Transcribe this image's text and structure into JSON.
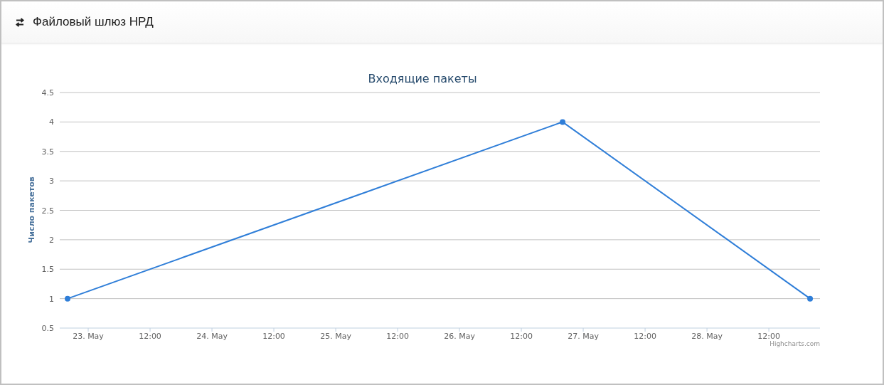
{
  "header": {
    "title": "Файловый шлюз НРД"
  },
  "chart": {
    "credits": "Highcharts.com",
    "chart_data": {
      "type": "line",
      "title": "Входящие пакеты",
      "ylabel": "Число пакетов",
      "categories": [
        null,
        "23. May",
        null,
        null,
        "12:00",
        null,
        null,
        "24. May",
        null,
        null,
        "12:00",
        null,
        null,
        "25. May",
        null,
        null,
        "12:00",
        null,
        null,
        "26. May",
        null,
        null,
        "12:00",
        null,
        null,
        "27. May",
        null,
        null,
        "12:00",
        null,
        null,
        "28. May",
        null,
        null,
        "12:00",
        null,
        null
      ],
      "grid": true,
      "series": [
        {
          "color": "#2f7ed8",
          "marker": true,
          "values": [
            1,
            null,
            null,
            null,
            null,
            null,
            null,
            null,
            null,
            null,
            null,
            null,
            null,
            null,
            null,
            null,
            null,
            null,
            null,
            null,
            null,
            null,
            null,
            null,
            4,
            null,
            null,
            null,
            null,
            null,
            null,
            null,
            null,
            null,
            null,
            null,
            1
          ]
        }
      ],
      "ylim": [
        0.5,
        4.5
      ],
      "yticks": [
        {
          "value": 0.5,
          "label": "0.5"
        },
        {
          "value": 1,
          "label": "1"
        },
        {
          "value": 1.5,
          "label": "1.5"
        },
        {
          "value": 2,
          "label": "2"
        },
        {
          "value": 2.5,
          "label": "2.5"
        },
        {
          "value": 3,
          "label": "3"
        },
        {
          "value": 3.5,
          "label": "3.5"
        },
        {
          "value": 4,
          "label": "4"
        },
        {
          "value": 4.5,
          "label": "4.5"
        }
      ]
    }
  }
}
